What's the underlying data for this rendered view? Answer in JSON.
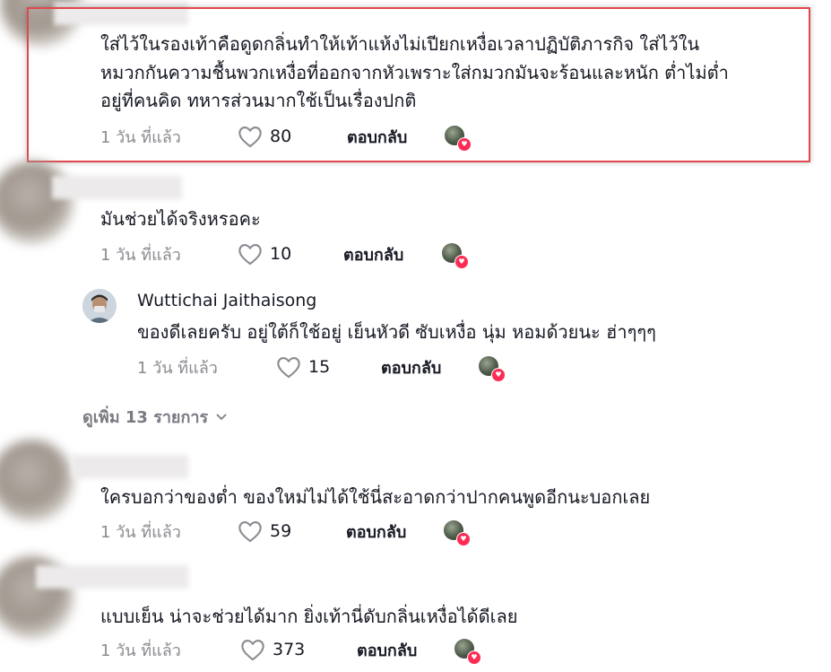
{
  "comments": [
    {
      "text_lines": [
        "ใส่ไว้ในรองเท้าคือดูดกลิ่นทำให้เท้าแห้งไม่เปียกเหงื่อเวลาปฏิบัติภารกิจ ใส่ไว้ใน",
        "หมวกกันความชื้นพวกเหงื่อที่ออกจากหัวเพราะใส่กมวกมันจะร้อนและหนัก ต่ำไม่ต่ำ",
        "อยู่ที่คนคิด ทหารส่วนมากใช้เป็นเรื่องปกติ"
      ],
      "time": "1 วัน ที่แล้ว",
      "likes": "80",
      "reply_label": "ตอบกลับ"
    },
    {
      "text_lines": [
        "มันช่วยได้จริงหรอคะ"
      ],
      "time": "1 วัน ที่แล้ว",
      "likes": "10",
      "reply_label": "ตอบกลับ"
    },
    {
      "text_lines": [
        "ใครบอกว่าของต่ำ ของใหม่ไม่ได้ใช้นี่สะอาดกว่าปากคนพูดอีกนะบอกเลย"
      ],
      "time": "1 วัน ที่แล้ว",
      "likes": "59",
      "reply_label": "ตอบกลับ"
    },
    {
      "text_lines": [
        "แบบเย็น น่าจะช่วยได้มาก ยิ่งเท้านี่ดับกลิ่นเหงื่อได้ดีเลย"
      ],
      "time": "1 วัน ที่แล้ว",
      "likes": "373",
      "reply_label": "ตอบกลับ"
    }
  ],
  "reply": {
    "author": "Wuttichai Jaithaisong",
    "text": "ของดีเลยครับ อยู่ใต้ก็ใช้อยู่ เย็นหัวดี ซับเหงื่อ นุ่ม หอมด้วยนะ ฮ่าๆๆๆ",
    "time": "1 วัน ที่แล้ว",
    "likes": "15",
    "reply_label": "ตอบกลับ"
  },
  "view_more": "ดูเพิ่ม 13 รายการ",
  "icons": {
    "like": "heart-outline-icon",
    "creator_liked": "creator-liked-badge-icon",
    "expand": "chevron-down-icon"
  },
  "colors": {
    "highlight_border": "#e0484d",
    "creator_heart": "#fe2c55",
    "meta_text": "#8a8b91"
  }
}
